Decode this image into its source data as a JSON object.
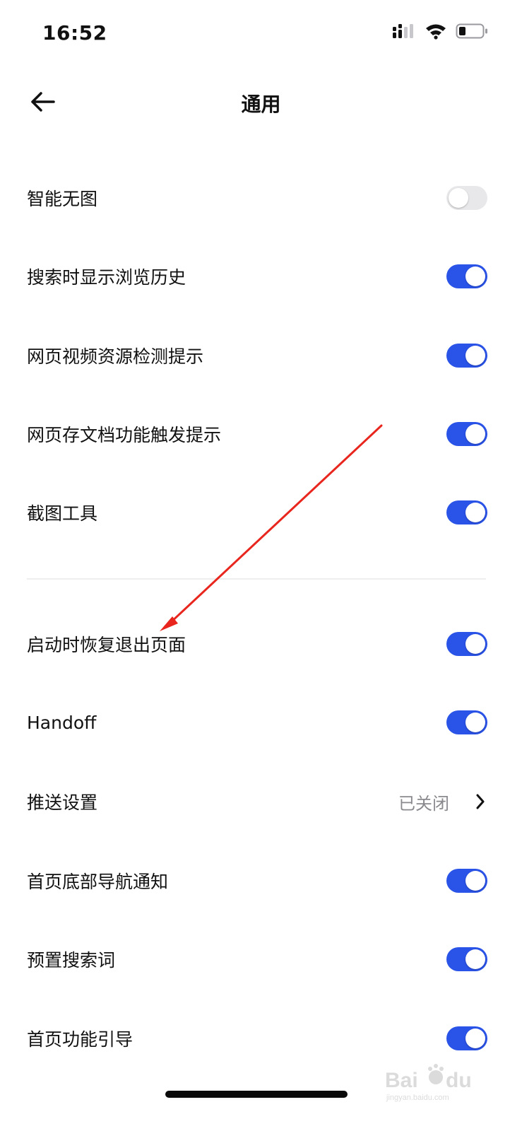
{
  "status_bar": {
    "time": "16:52"
  },
  "header": {
    "title": "通用"
  },
  "settings": [
    {
      "label": "智能无图",
      "on": false
    },
    {
      "label": "搜索时显示浏览历史",
      "on": true
    },
    {
      "label": "网页视频资源检测提示",
      "on": true
    },
    {
      "label": "网页存文档功能触发提示",
      "on": true
    },
    {
      "label": "截图工具",
      "on": true
    }
  ],
  "settings2": [
    {
      "label": "启动时恢复退出页面",
      "on": true
    },
    {
      "label": "Handoff",
      "on": true
    }
  ],
  "push": {
    "label": "推送设置",
    "value": "已关闭"
  },
  "settings3": [
    {
      "label": "首页底部导航通知",
      "on": true
    },
    {
      "label": "预置搜索词",
      "on": true
    },
    {
      "label": "首页功能引导",
      "on": true
    }
  ],
  "colors": {
    "accent": "#2a53e8",
    "toggle_off": "#e8e8ea",
    "annotation": "#e8261e"
  }
}
